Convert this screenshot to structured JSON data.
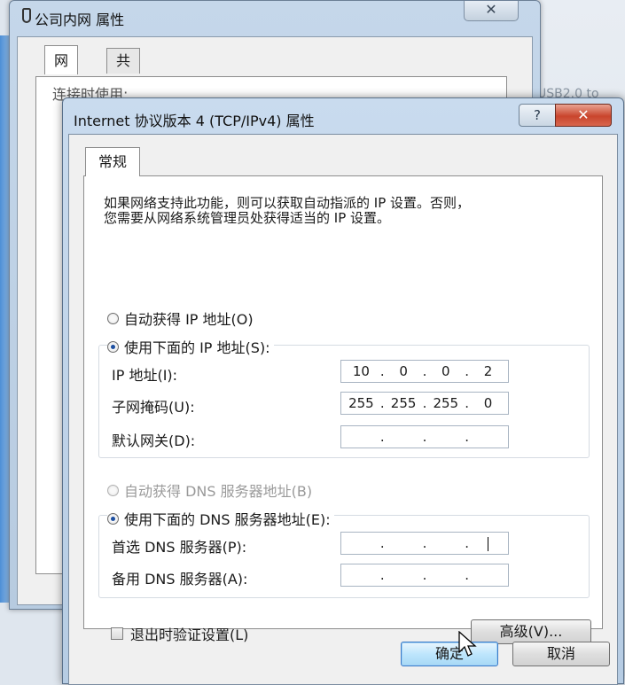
{
  "background": {
    "side_text": "USB2.0 to"
  },
  "back_window": {
    "title": "公司内网 属性",
    "close_glyph": "✕",
    "tabs": [
      {
        "label": "网络",
        "active": true
      },
      {
        "label": "共享",
        "active": false
      }
    ],
    "partial_label": "连接时使用:"
  },
  "dialog": {
    "title": "Internet 协议版本 4 (TCP/IPv4) 属性",
    "help_glyph": "?",
    "close_glyph": "✕",
    "tab": "常规",
    "description_line1": "如果网络支持此功能，则可以获取自动指派的 IP 设置。否则，",
    "description_line2": "您需要从网络系统管理员处获得适当的 IP 设置。",
    "ip_auto_label": "自动获得 IP 地址(O)",
    "ip_manual_label": "使用下面的 IP 地址(S):",
    "ip_mode": "manual",
    "ip_address_label": "IP 地址(I):",
    "ip_address": [
      "10",
      "0",
      "0",
      "2"
    ],
    "subnet_label": "子网掩码(U):",
    "subnet": [
      "255",
      "255",
      "255",
      "0"
    ],
    "gateway_label": "默认网关(D):",
    "gateway": [
      "",
      "",
      "",
      ""
    ],
    "dns_auto_label": "自动获得 DNS 服务器地址(B)",
    "dns_manual_label": "使用下面的 DNS 服务器地址(E):",
    "dns_mode": "manual",
    "dns_preferred_label": "首选 DNS 服务器(P):",
    "dns_preferred": [
      "",
      "",
      "",
      ""
    ],
    "dns_alternate_label": "备用 DNS 服务器(A):",
    "dns_alternate": [
      "",
      "",
      "",
      ""
    ],
    "validate_label": "退出时验证设置(L)",
    "validate_checked": false,
    "advanced_button": "高级(V)...",
    "ok_button": "确定",
    "cancel_button": "取消"
  }
}
